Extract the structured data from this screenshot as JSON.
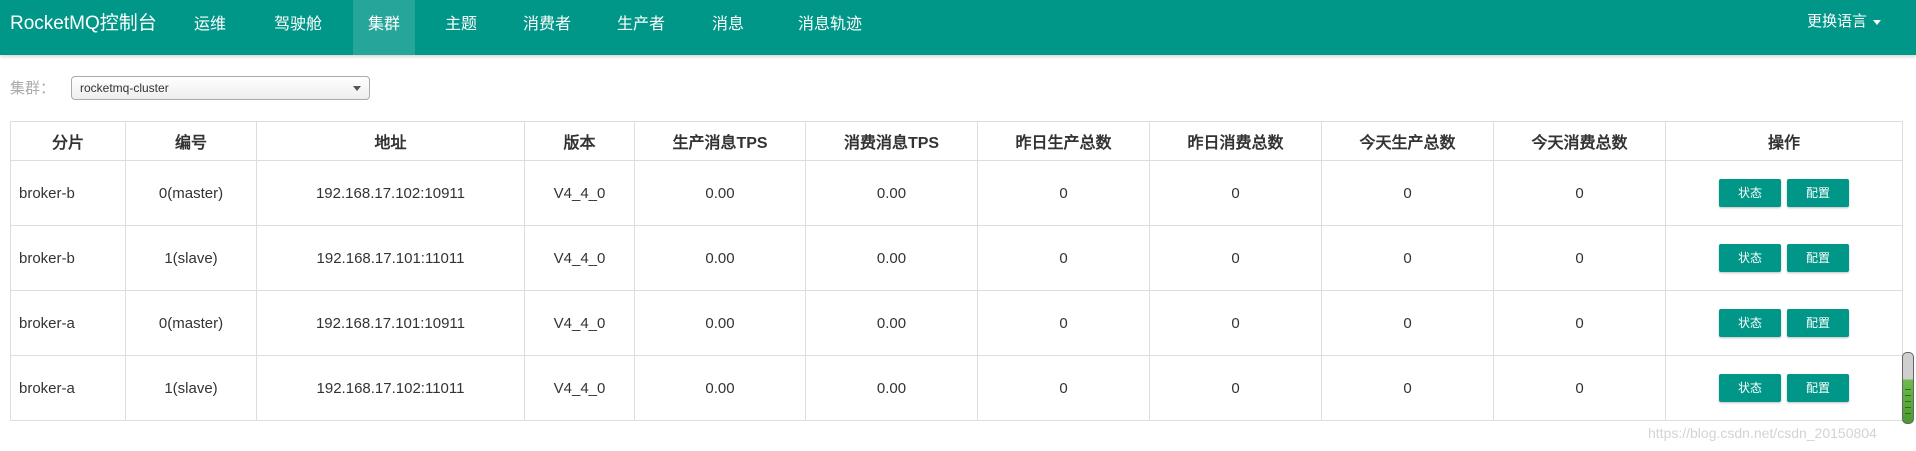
{
  "nav": {
    "brand": "RocketMQ控制台",
    "items": [
      {
        "label": "运维",
        "active": false
      },
      {
        "label": "驾驶舱",
        "active": false
      },
      {
        "label": "集群",
        "active": true
      },
      {
        "label": "主题",
        "active": false
      },
      {
        "label": "消费者",
        "active": false
      },
      {
        "label": "生产者",
        "active": false
      },
      {
        "label": "消息",
        "active": false
      },
      {
        "label": "消息轨迹",
        "active": false
      }
    ],
    "language": "更换语言"
  },
  "cluster": {
    "label": "集群：",
    "selected": "rocketmq-cluster"
  },
  "table": {
    "headers": [
      "分片",
      "编号",
      "地址",
      "版本",
      "生产消息TPS",
      "消费消息TPS",
      "昨日生产总数",
      "昨日消费总数",
      "今天生产总数",
      "今天消费总数",
      "操作"
    ],
    "rows": [
      {
        "shard": "broker-b",
        "id": "0(master)",
        "address": "192.168.17.102:10911",
        "version": "V4_4_0",
        "produce_tps": "0.00",
        "consume_tps": "0.00",
        "yesterday_produce": "0",
        "yesterday_consume": "0",
        "today_produce": "0",
        "today_consume": "0"
      },
      {
        "shard": "broker-b",
        "id": "1(slave)",
        "address": "192.168.17.101:11011",
        "version": "V4_4_0",
        "produce_tps": "0.00",
        "consume_tps": "0.00",
        "yesterday_produce": "0",
        "yesterday_consume": "0",
        "today_produce": "0",
        "today_consume": "0"
      },
      {
        "shard": "broker-a",
        "id": "0(master)",
        "address": "192.168.17.101:10911",
        "version": "V4_4_0",
        "produce_tps": "0.00",
        "consume_tps": "0.00",
        "yesterday_produce": "0",
        "yesterday_consume": "0",
        "today_produce": "0",
        "today_consume": "0"
      },
      {
        "shard": "broker-a",
        "id": "1(slave)",
        "address": "192.168.17.102:11011",
        "version": "V4_4_0",
        "produce_tps": "0.00",
        "consume_tps": "0.00",
        "yesterday_produce": "0",
        "yesterday_consume": "0",
        "today_produce": "0",
        "today_consume": "0"
      }
    ],
    "status_button": "状态",
    "config_button": "配置"
  },
  "watermark": "https://blog.csdn.net/csdn_20150804",
  "colors": {
    "primary": "#009688",
    "nav_active": "#26a69a"
  }
}
